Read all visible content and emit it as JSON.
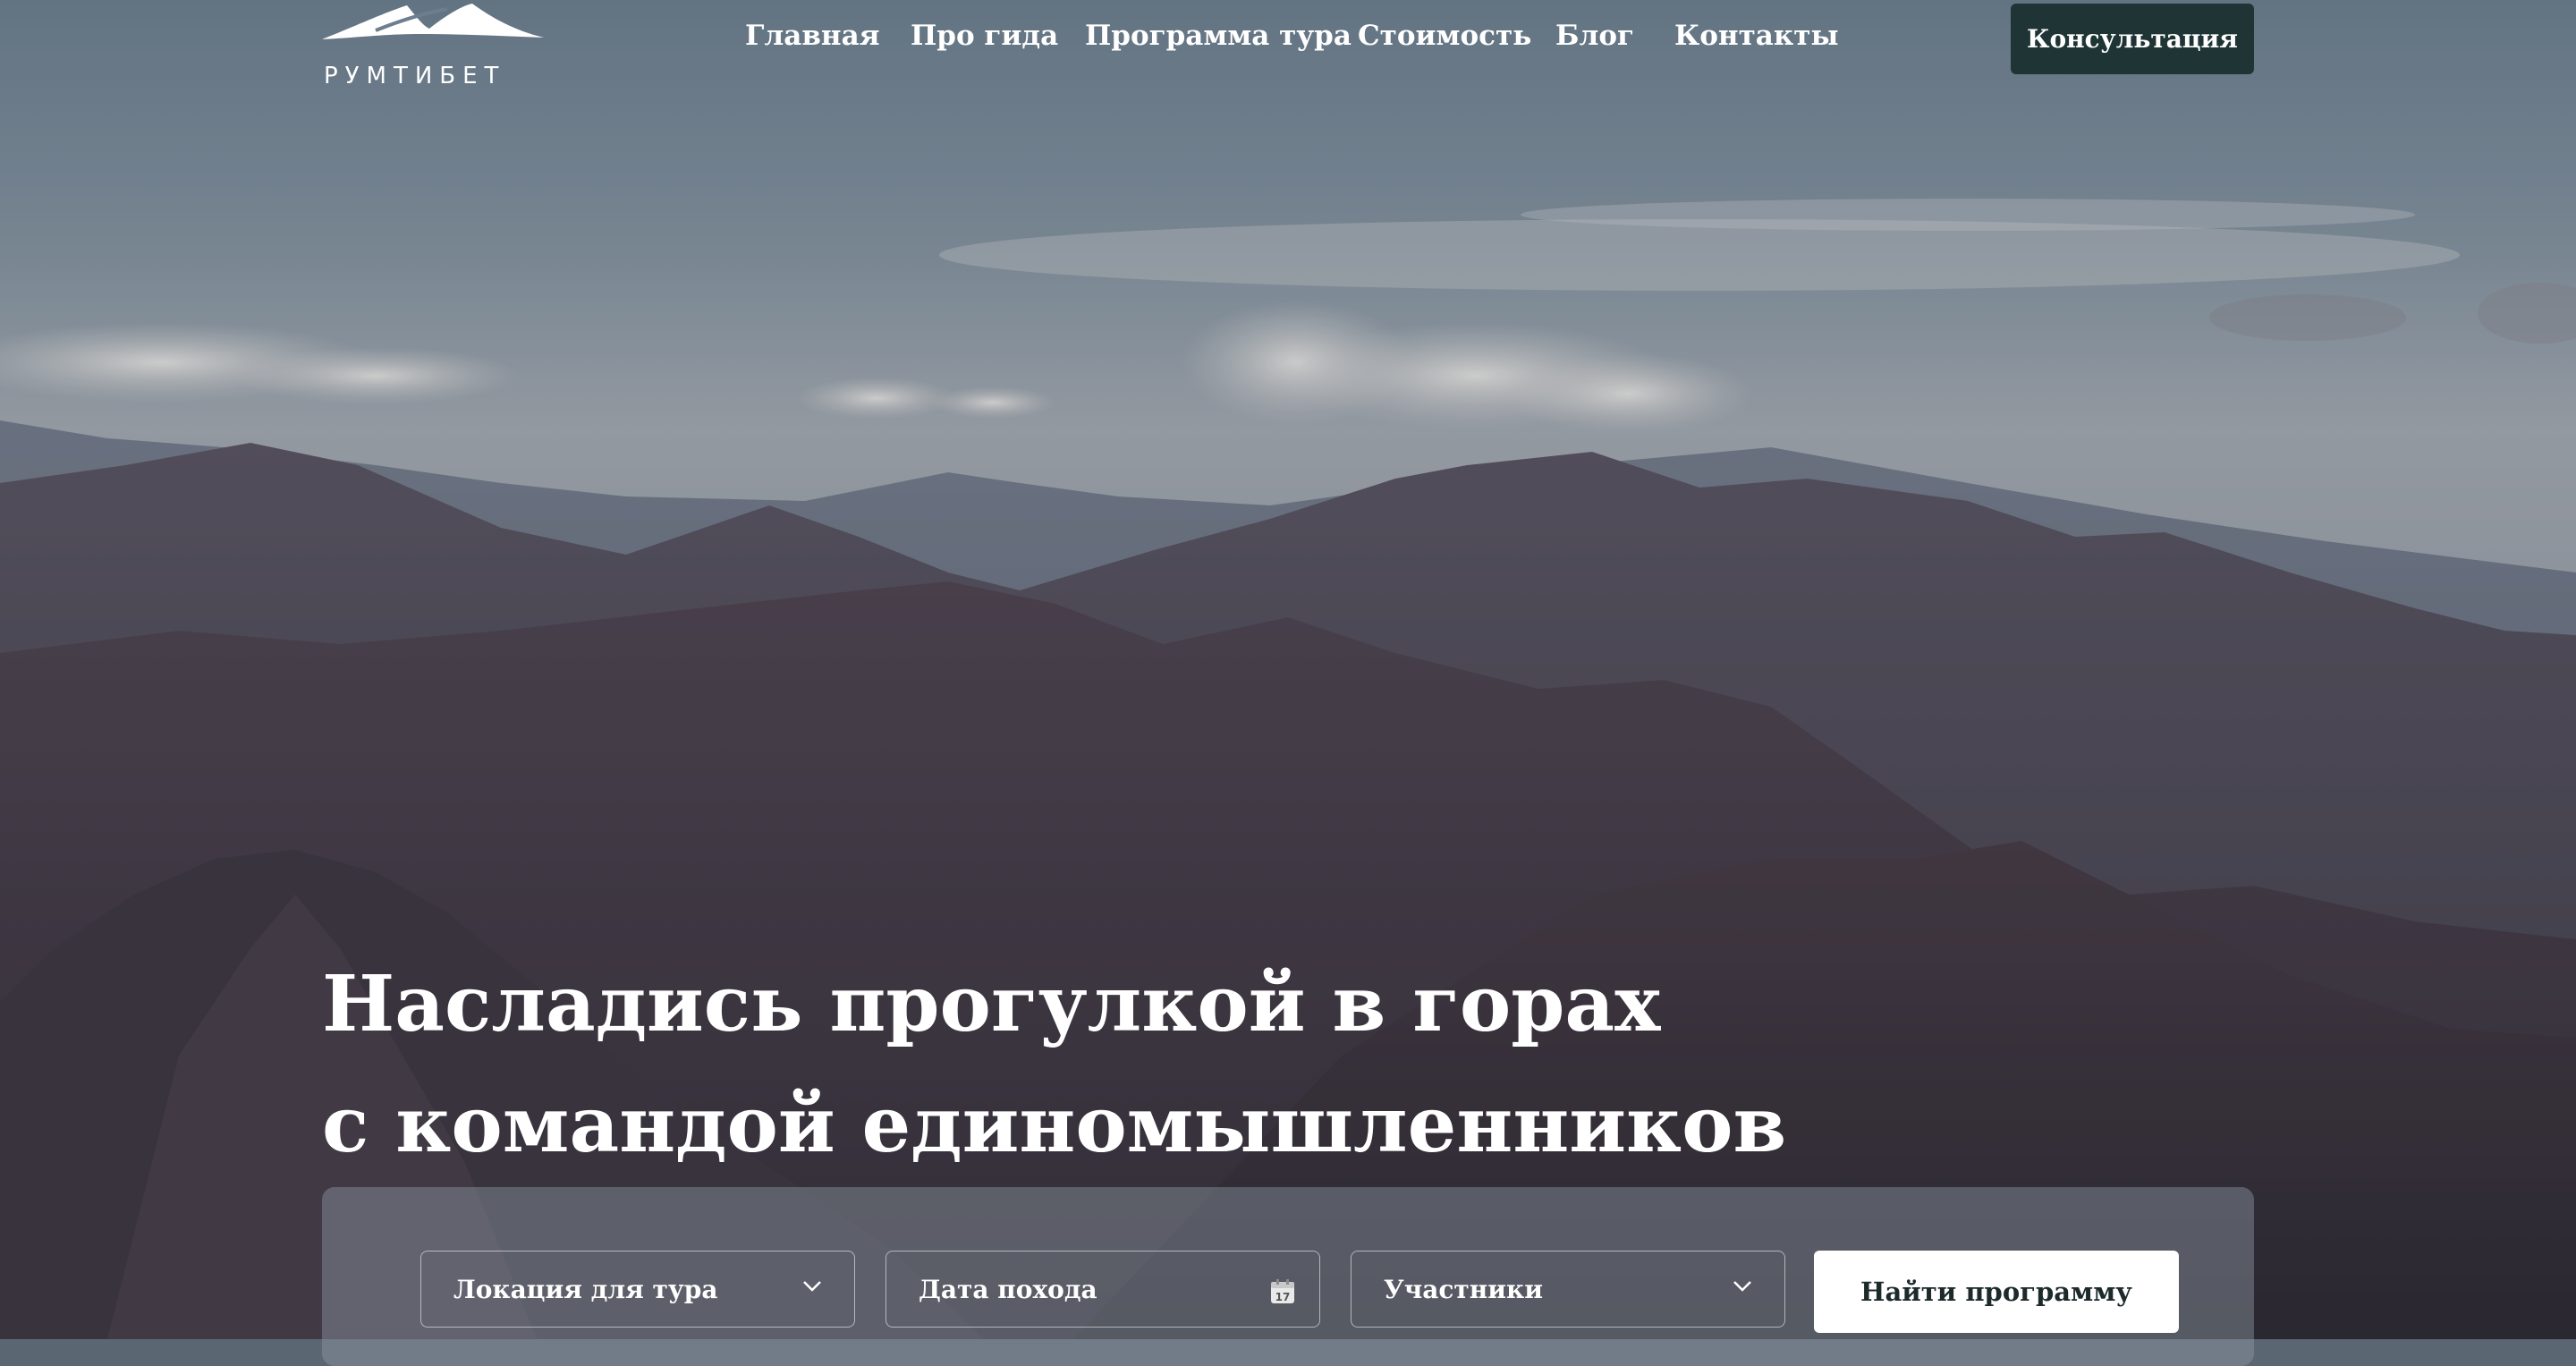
{
  "brand": {
    "name": "РУМТИБЕТ"
  },
  "nav": {
    "items": [
      {
        "label": "Главная"
      },
      {
        "label": "Про гида"
      },
      {
        "label": "Программа тура"
      },
      {
        "label": "Стоимость"
      },
      {
        "label": "Блог"
      },
      {
        "label": "Контакты"
      }
    ],
    "cta_label": "Консультация"
  },
  "hero": {
    "headline_line1": "Насладись прогулкой в горах",
    "headline_line2": "с командой единомышленников"
  },
  "search": {
    "location_placeholder": "Локация для тура",
    "date_placeholder": "Дата похода",
    "calendar_day": "17",
    "participants_placeholder": "Участники",
    "submit_label": "Найти программу"
  },
  "colors": {
    "cta_bg": "#1f3434",
    "sky_top": "#6e8090",
    "mountain_dark": "#3e3a44"
  },
  "icons": [
    "mountain-logo-icon",
    "chevron-down-icon",
    "calendar-icon"
  ]
}
